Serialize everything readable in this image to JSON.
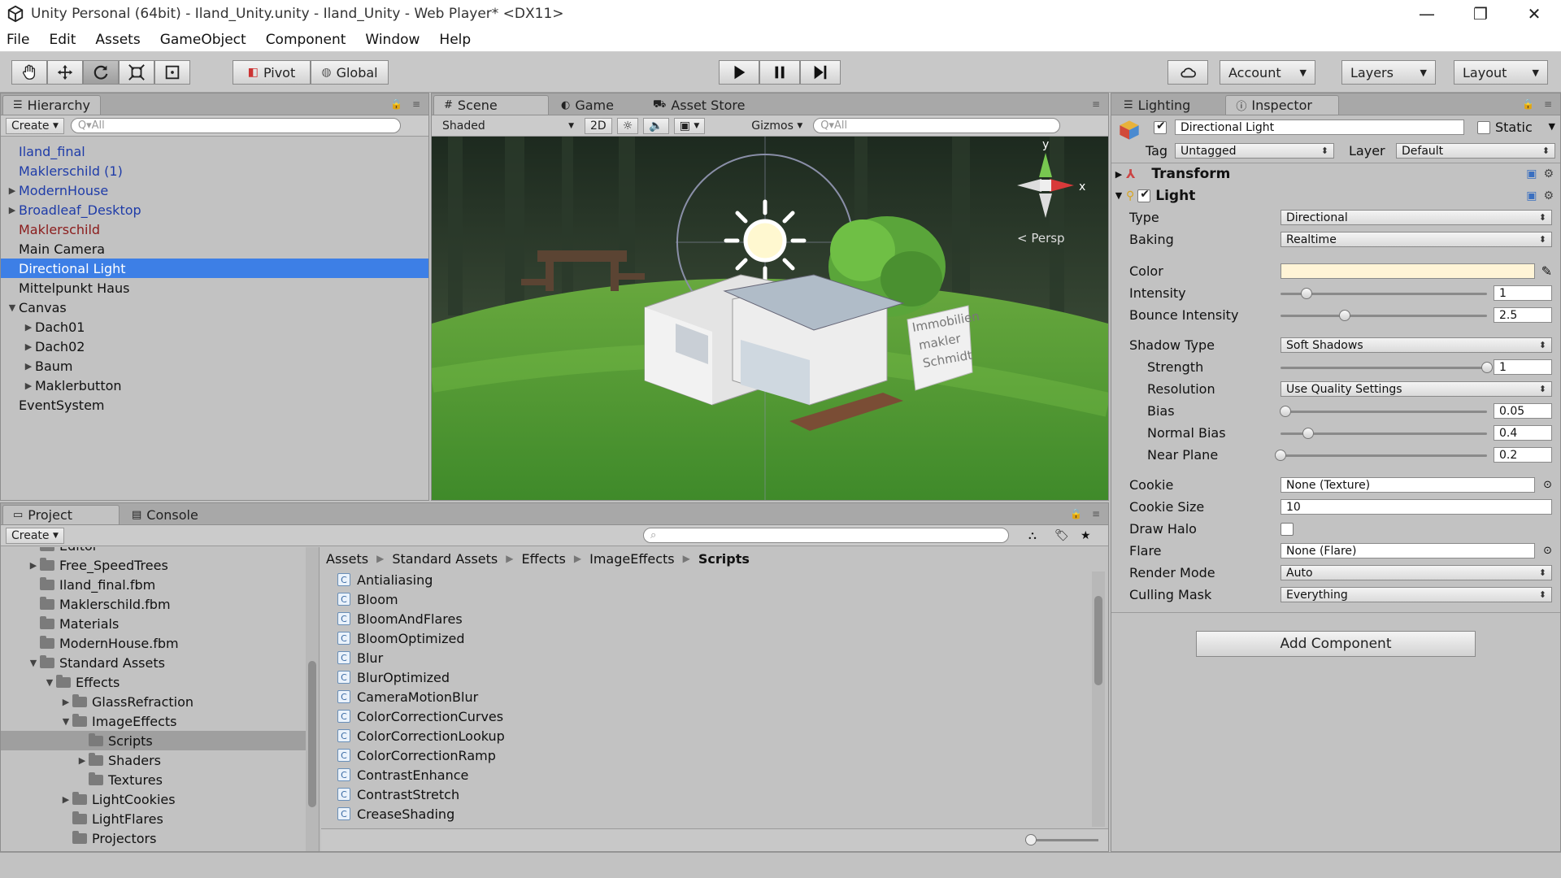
{
  "window": {
    "title": "Unity Personal (64bit) - Iland_Unity.unity - Iland_Unity - Web Player* <DX11>"
  },
  "menu": [
    "File",
    "Edit",
    "Assets",
    "GameObject",
    "Component",
    "Window",
    "Help"
  ],
  "toolbar": {
    "pivot": "Pivot",
    "global": "Global",
    "account": "Account",
    "layers": "Layers",
    "layout": "Layout"
  },
  "hierarchy": {
    "tab": "Hierarchy",
    "create": "Create",
    "search_placeholder": "Q▾All",
    "items": [
      {
        "label": "Iland_final",
        "style": "prefab",
        "indent": 0,
        "arrow": ""
      },
      {
        "label": "Maklerschild (1)",
        "style": "prefab",
        "indent": 0,
        "arrow": ""
      },
      {
        "label": "ModernHouse",
        "style": "prefab",
        "indent": 0,
        "arrow": "▶"
      },
      {
        "label": "Broadleaf_Desktop",
        "style": "prefab",
        "indent": 0,
        "arrow": "▶"
      },
      {
        "label": "Maklerschild",
        "style": "missing",
        "indent": 0,
        "arrow": ""
      },
      {
        "label": "Main Camera",
        "style": "normal",
        "indent": 0,
        "arrow": ""
      },
      {
        "label": "Directional Light",
        "style": "selected",
        "indent": 0,
        "arrow": ""
      },
      {
        "label": "Mittelpunkt Haus",
        "style": "normal",
        "indent": 0,
        "arrow": ""
      },
      {
        "label": "Canvas",
        "style": "normal",
        "indent": 0,
        "arrow": "▼"
      },
      {
        "label": "Dach01",
        "style": "normal",
        "indent": 1,
        "arrow": "▶"
      },
      {
        "label": "Dach02",
        "style": "normal",
        "indent": 1,
        "arrow": "▶"
      },
      {
        "label": "Baum",
        "style": "normal",
        "indent": 1,
        "arrow": "▶"
      },
      {
        "label": "Maklerbutton",
        "style": "normal",
        "indent": 1,
        "arrow": "▶"
      },
      {
        "label": "EventSystem",
        "style": "normal",
        "indent": 0,
        "arrow": ""
      }
    ]
  },
  "scene": {
    "tabs": [
      "Scene",
      "Game",
      "Asset Store"
    ],
    "shading": "Shaded",
    "mode2d": "2D",
    "gizmos": "Gizmos",
    "search_placeholder": "Q▾All",
    "persp": "< Persp",
    "axis_y": "y",
    "axis_x": "x",
    "sign_text": [
      "Immobilien",
      "makler",
      "Schmidt"
    ]
  },
  "inspector": {
    "tabs": [
      "Lighting",
      "Inspector"
    ],
    "object_name": "Directional Light",
    "static_label": "Static",
    "tag_label": "Tag",
    "tag_value": "Untagged",
    "layer_label": "Layer",
    "layer_value": "Default",
    "transform": "Transform",
    "light": "Light",
    "props": {
      "type": {
        "label": "Type",
        "value": "Directional"
      },
      "baking": {
        "label": "Baking",
        "value": "Realtime"
      },
      "color": {
        "label": "Color",
        "value": "#fff4d6"
      },
      "intensity": {
        "label": "Intensity",
        "value": "1",
        "fraction": 0.125
      },
      "bounce": {
        "label": "Bounce Intensity",
        "value": "2.5",
        "fraction": 0.3125
      },
      "shadow_type": {
        "label": "Shadow Type",
        "value": "Soft Shadows"
      },
      "strength": {
        "label": "Strength",
        "value": "1",
        "fraction": 1.0
      },
      "resolution": {
        "label": "Resolution",
        "value": "Use Quality Settings"
      },
      "bias": {
        "label": "Bias",
        "value": "0.05",
        "fraction": 0.025
      },
      "normal_bias": {
        "label": "Normal Bias",
        "value": "0.4",
        "fraction": 0.133
      },
      "near_plane": {
        "label": "Near Plane",
        "value": "0.2",
        "fraction": 0.0
      },
      "cookie": {
        "label": "Cookie",
        "value": "None (Texture)"
      },
      "cookie_size": {
        "label": "Cookie Size",
        "value": "10"
      },
      "draw_halo": {
        "label": "Draw Halo"
      },
      "flare": {
        "label": "Flare",
        "value": "None (Flare)"
      },
      "render_mode": {
        "label": "Render Mode",
        "value": "Auto"
      },
      "culling_mask": {
        "label": "Culling Mask",
        "value": "Everything"
      }
    },
    "add_component": "Add Component"
  },
  "project": {
    "tabs": [
      "Project",
      "Console"
    ],
    "create": "Create",
    "tree": [
      {
        "label": "Editor",
        "indent": 1,
        "arrow": ""
      },
      {
        "label": "Free_SpeedTrees",
        "indent": 1,
        "arrow": "▶"
      },
      {
        "label": "Iland_final.fbm",
        "indent": 1,
        "arrow": ""
      },
      {
        "label": "Maklerschild.fbm",
        "indent": 1,
        "arrow": ""
      },
      {
        "label": "Materials",
        "indent": 1,
        "arrow": ""
      },
      {
        "label": "ModernHouse.fbm",
        "indent": 1,
        "arrow": ""
      },
      {
        "label": "Standard Assets",
        "indent": 1,
        "arrow": "▼"
      },
      {
        "label": "Effects",
        "indent": 2,
        "arrow": "▼"
      },
      {
        "label": "GlassRefraction",
        "indent": 3,
        "arrow": "▶"
      },
      {
        "label": "ImageEffects",
        "indent": 3,
        "arrow": "▼"
      },
      {
        "label": "Scripts",
        "indent": 4,
        "arrow": "",
        "selected": true
      },
      {
        "label": "Shaders",
        "indent": 4,
        "arrow": "▶"
      },
      {
        "label": "Textures",
        "indent": 4,
        "arrow": ""
      },
      {
        "label": "LightCookies",
        "indent": 3,
        "arrow": "▶"
      },
      {
        "label": "LightFlares",
        "indent": 3,
        "arrow": ""
      },
      {
        "label": "Projectors",
        "indent": 3,
        "arrow": ""
      }
    ],
    "breadcrumb": [
      "Assets",
      "Standard Assets",
      "Effects",
      "ImageEffects",
      "Scripts"
    ],
    "files": [
      "Antialiasing",
      "Bloom",
      "BloomAndFlares",
      "BloomOptimized",
      "Blur",
      "BlurOptimized",
      "CameraMotionBlur",
      "ColorCorrectionCurves",
      "ColorCorrectionLookup",
      "ColorCorrectionRamp",
      "ContrastEnhance",
      "ContrastStretch",
      "CreaseShading"
    ]
  }
}
